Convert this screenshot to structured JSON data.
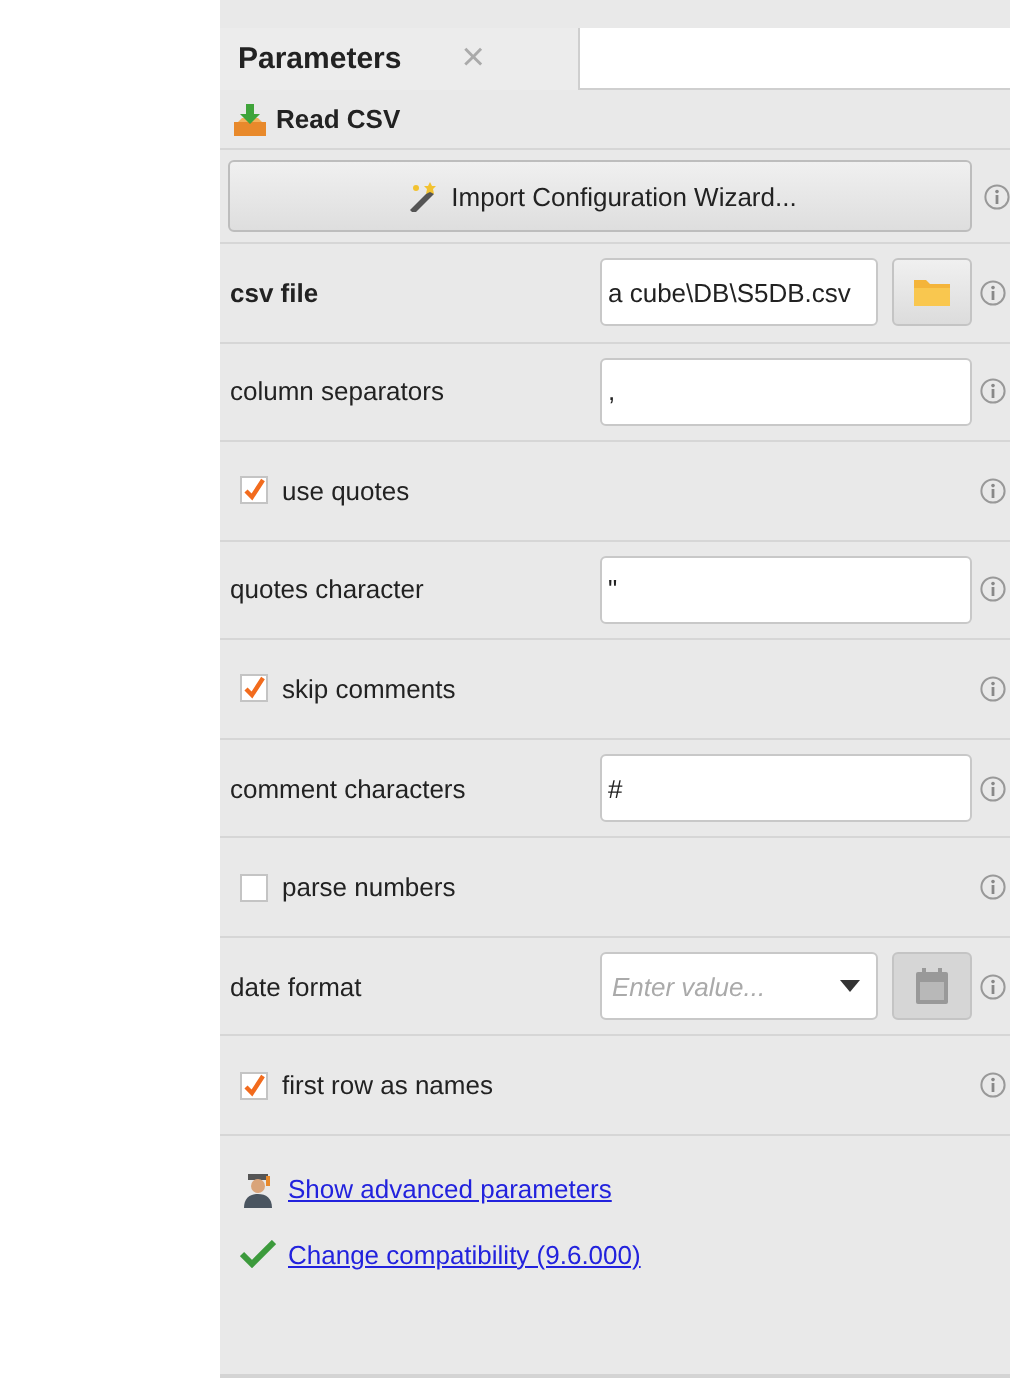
{
  "tabs": [
    {
      "label": "Parameters",
      "close": "×"
    }
  ],
  "operator": {
    "title": "Read CSV"
  },
  "wizard_button": {
    "label": "Import Configuration Wizard..."
  },
  "parameters": [
    {
      "kind": "file",
      "label": "csv file",
      "required": true,
      "value": "a cube\\DB\\S5DB.csv"
    },
    {
      "kind": "text",
      "label": "column separators",
      "required": false,
      "value": ","
    },
    {
      "kind": "check",
      "label": "use quotes",
      "checked": true
    },
    {
      "kind": "text",
      "label": "quotes character",
      "required": false,
      "value": "\""
    },
    {
      "kind": "check",
      "label": "skip comments",
      "checked": true
    },
    {
      "kind": "text",
      "label": "comment characters",
      "required": false,
      "value": "#"
    },
    {
      "kind": "check",
      "label": "parse numbers",
      "checked": false
    },
    {
      "kind": "date",
      "label": "date format",
      "required": false,
      "placeholder": "Enter value..."
    },
    {
      "kind": "check",
      "label": "first row as names",
      "checked": true
    }
  ],
  "links": [
    {
      "kind": "advanced",
      "label": "Show advanced parameters"
    },
    {
      "kind": "compat",
      "label": "Change compatibility (9.6.000)"
    }
  ]
}
